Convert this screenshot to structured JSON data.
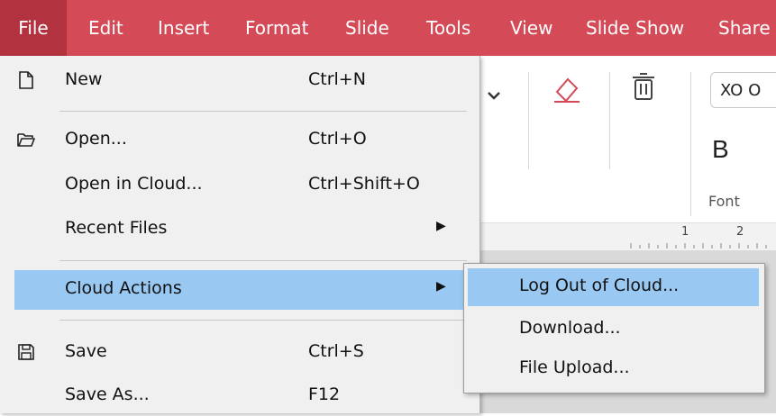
{
  "menubar": {
    "items": [
      "File",
      "Edit",
      "Insert",
      "Format",
      "Slide",
      "Tools",
      "View",
      "Slide Show",
      "Share"
    ]
  },
  "toolbar": {
    "font_name": "XO O",
    "bold_label": "B",
    "group_label": "Font",
    "icons": [
      "chevron-down-icon",
      "eraser-icon",
      "trash-icon"
    ]
  },
  "ruler": {
    "ticks": [
      "1",
      "2"
    ]
  },
  "file_menu": {
    "items": [
      {
        "label": "New",
        "shortcut": "Ctrl+N",
        "icon": "new-document-icon"
      },
      {
        "label": "Open...",
        "shortcut": "Ctrl+O",
        "icon": "folder-open-icon"
      },
      {
        "label": "Open in Cloud...",
        "shortcut": "Ctrl+Shift+O"
      },
      {
        "label": "Recent Files",
        "submenu": true
      },
      {
        "label": "Cloud Actions",
        "submenu": true,
        "highlighted": true
      },
      {
        "label": "Save",
        "shortcut": "Ctrl+S",
        "icon": "save-icon"
      },
      {
        "label": "Save As...",
        "shortcut": "F12"
      }
    ]
  },
  "cloud_submenu": {
    "items": [
      {
        "label": "Log Out of Cloud...",
        "highlighted": true
      },
      {
        "label": "Download..."
      },
      {
        "label": "File Upload..."
      }
    ]
  },
  "colors": {
    "menubar_bg": "#d44a57",
    "menubar_active": "#b2323f",
    "highlight": "#99c9f2",
    "menu_bg": "#f0f0f0"
  }
}
